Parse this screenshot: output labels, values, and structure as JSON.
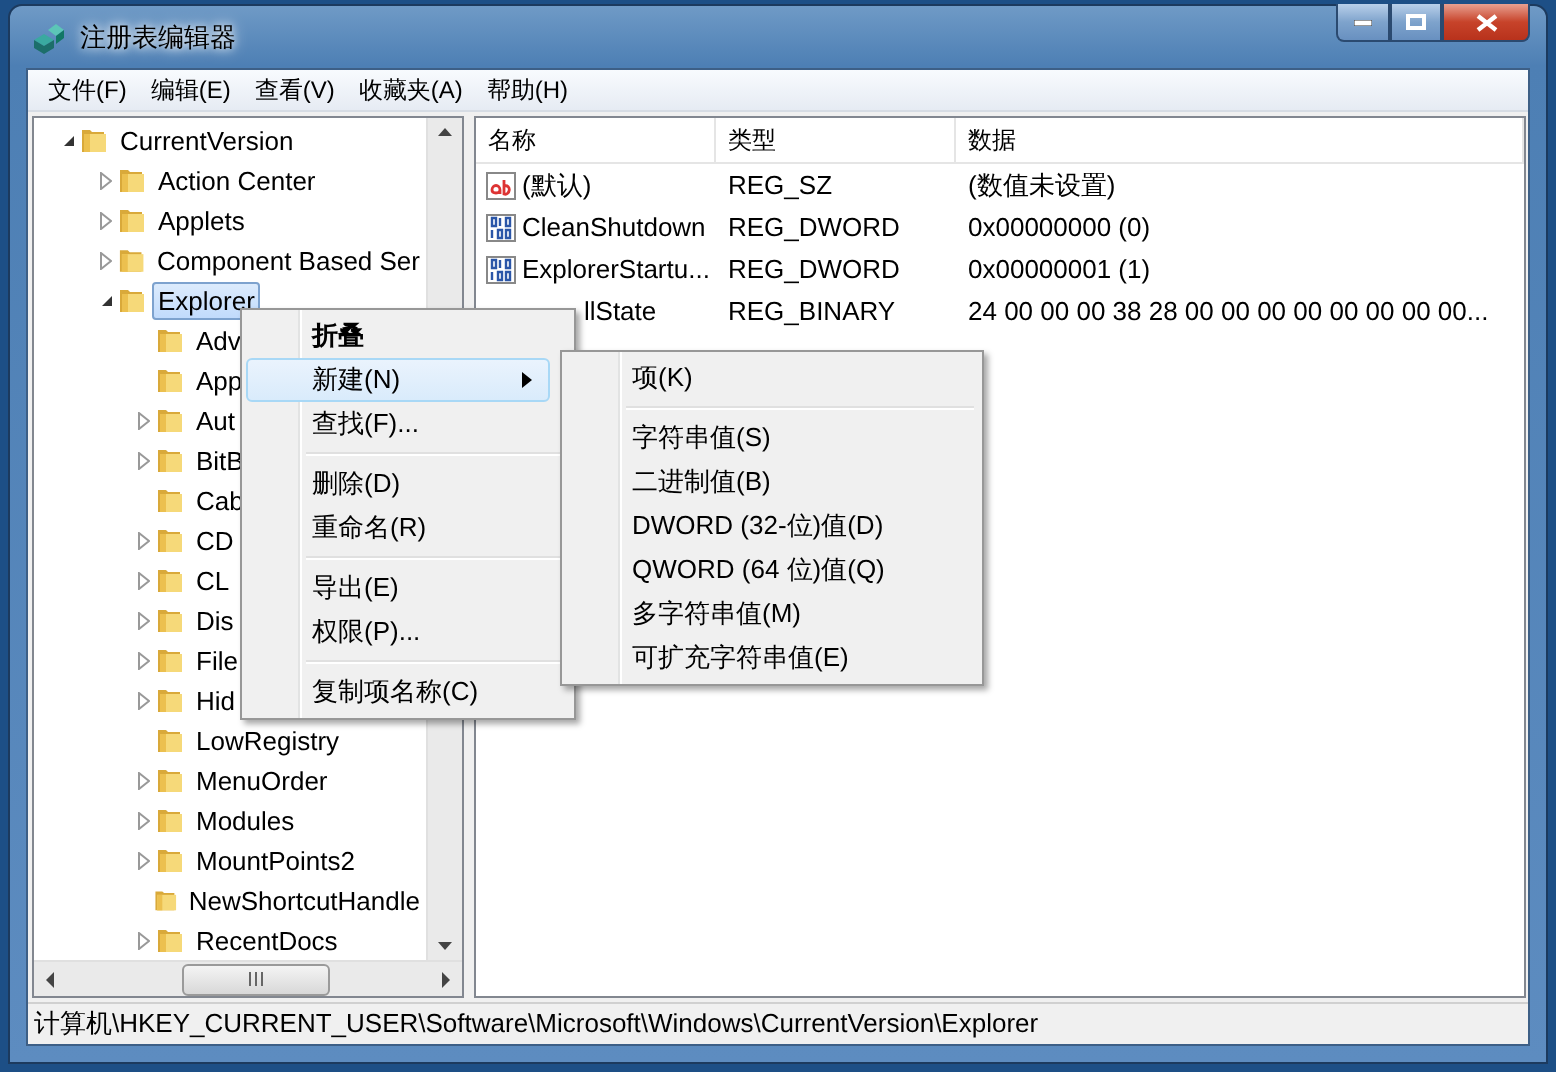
{
  "window": {
    "title": "注册表编辑器"
  },
  "menu_bar": [
    "文件(F)",
    "编辑(E)",
    "查看(V)",
    "收藏夹(A)",
    "帮助(H)"
  ],
  "tree": [
    {
      "label": "CurrentVersion",
      "expanded": true,
      "selected": false,
      "children": [
        {
          "label": "Action Center",
          "expanded": false,
          "selected": false,
          "has_children": true
        },
        {
          "label": "Applets",
          "expanded": false,
          "selected": false,
          "has_children": true
        },
        {
          "label": "Component Based Ser",
          "expanded": false,
          "selected": false,
          "has_children": true
        },
        {
          "label": "Explorer",
          "expanded": true,
          "selected": true,
          "has_children": true,
          "children": [
            {
              "label": "Adv",
              "has_children": false,
              "selected": false
            },
            {
              "label": "App",
              "has_children": false,
              "selected": false
            },
            {
              "label": "Aut",
              "has_children": true,
              "selected": false
            },
            {
              "label": "BitB",
              "has_children": true,
              "selected": false
            },
            {
              "label": "Cab",
              "has_children": false,
              "selected": false
            },
            {
              "label": "CD",
              "has_children": true,
              "selected": false
            },
            {
              "label": "CL",
              "has_children": true,
              "selected": false
            },
            {
              "label": "Dis",
              "has_children": true,
              "selected": false
            },
            {
              "label": "File",
              "has_children": true,
              "selected": false
            },
            {
              "label": "Hid",
              "has_children": true,
              "selected": false
            },
            {
              "label": "LowRegistry",
              "has_children": false,
              "selected": false
            },
            {
              "label": "MenuOrder",
              "has_children": true,
              "selected": false
            },
            {
              "label": "Modules",
              "has_children": true,
              "selected": false
            },
            {
              "label": "MountPoints2",
              "has_children": true,
              "selected": false
            },
            {
              "label": "NewShortcutHandle",
              "has_children": false,
              "selected": false
            },
            {
              "label": "RecentDocs",
              "has_children": true,
              "selected": false
            }
          ]
        }
      ]
    }
  ],
  "table": {
    "columns": [
      "名称",
      "类型",
      "数据"
    ],
    "rows": [
      {
        "kind": "string",
        "name": "(默认)",
        "type": "REG_SZ",
        "data": "(数值未设置)"
      },
      {
        "kind": "number",
        "name": "CleanShutdown",
        "type": "REG_DWORD",
        "data": "0x00000000 (0)"
      },
      {
        "kind": "number",
        "name": "ExplorerStartu...",
        "type": "REG_DWORD",
        "data": "0x00000001 (1)"
      },
      {
        "kind": "covered",
        "name": "llState",
        "type": "REG_BINARY",
        "data": "24 00 00 00 38 28 00 00 00 00 00 00 00 00..."
      }
    ]
  },
  "context_menu": {
    "items": [
      {
        "kind": "item",
        "label": "折叠",
        "bold": true,
        "selected": false
      },
      {
        "kind": "item",
        "label": "新建(N)",
        "bold": false,
        "selected": true,
        "submenu": true
      },
      {
        "kind": "item",
        "label": "查找(F)...",
        "bold": false,
        "selected": false
      },
      {
        "kind": "separator"
      },
      {
        "kind": "item",
        "label": "删除(D)",
        "bold": false,
        "selected": false
      },
      {
        "kind": "item",
        "label": "重命名(R)",
        "bold": false,
        "selected": false
      },
      {
        "kind": "separator"
      },
      {
        "kind": "item",
        "label": "导出(E)",
        "bold": false,
        "selected": false
      },
      {
        "kind": "item",
        "label": "权限(P)...",
        "bold": false,
        "selected": false
      },
      {
        "kind": "separator"
      },
      {
        "kind": "item",
        "label": "复制项名称(C)",
        "bold": false,
        "selected": false
      }
    ]
  },
  "submenu": {
    "items": [
      {
        "kind": "item",
        "label": "项(K)"
      },
      {
        "kind": "separator"
      },
      {
        "kind": "item",
        "label": "字符串值(S)"
      },
      {
        "kind": "item",
        "label": "二进制值(B)"
      },
      {
        "kind": "item",
        "label": "DWORD (32-位)值(D)"
      },
      {
        "kind": "item",
        "label": "QWORD (64 位)值(Q)"
      },
      {
        "kind": "item",
        "label": "多字符串值(M)"
      },
      {
        "kind": "item",
        "label": "可扩充字符串值(E)"
      }
    ]
  },
  "status_bar": "计算机\\HKEY_CURRENT_USER\\Software\\Microsoft\\Windows\\CurrentVersion\\Explorer"
}
